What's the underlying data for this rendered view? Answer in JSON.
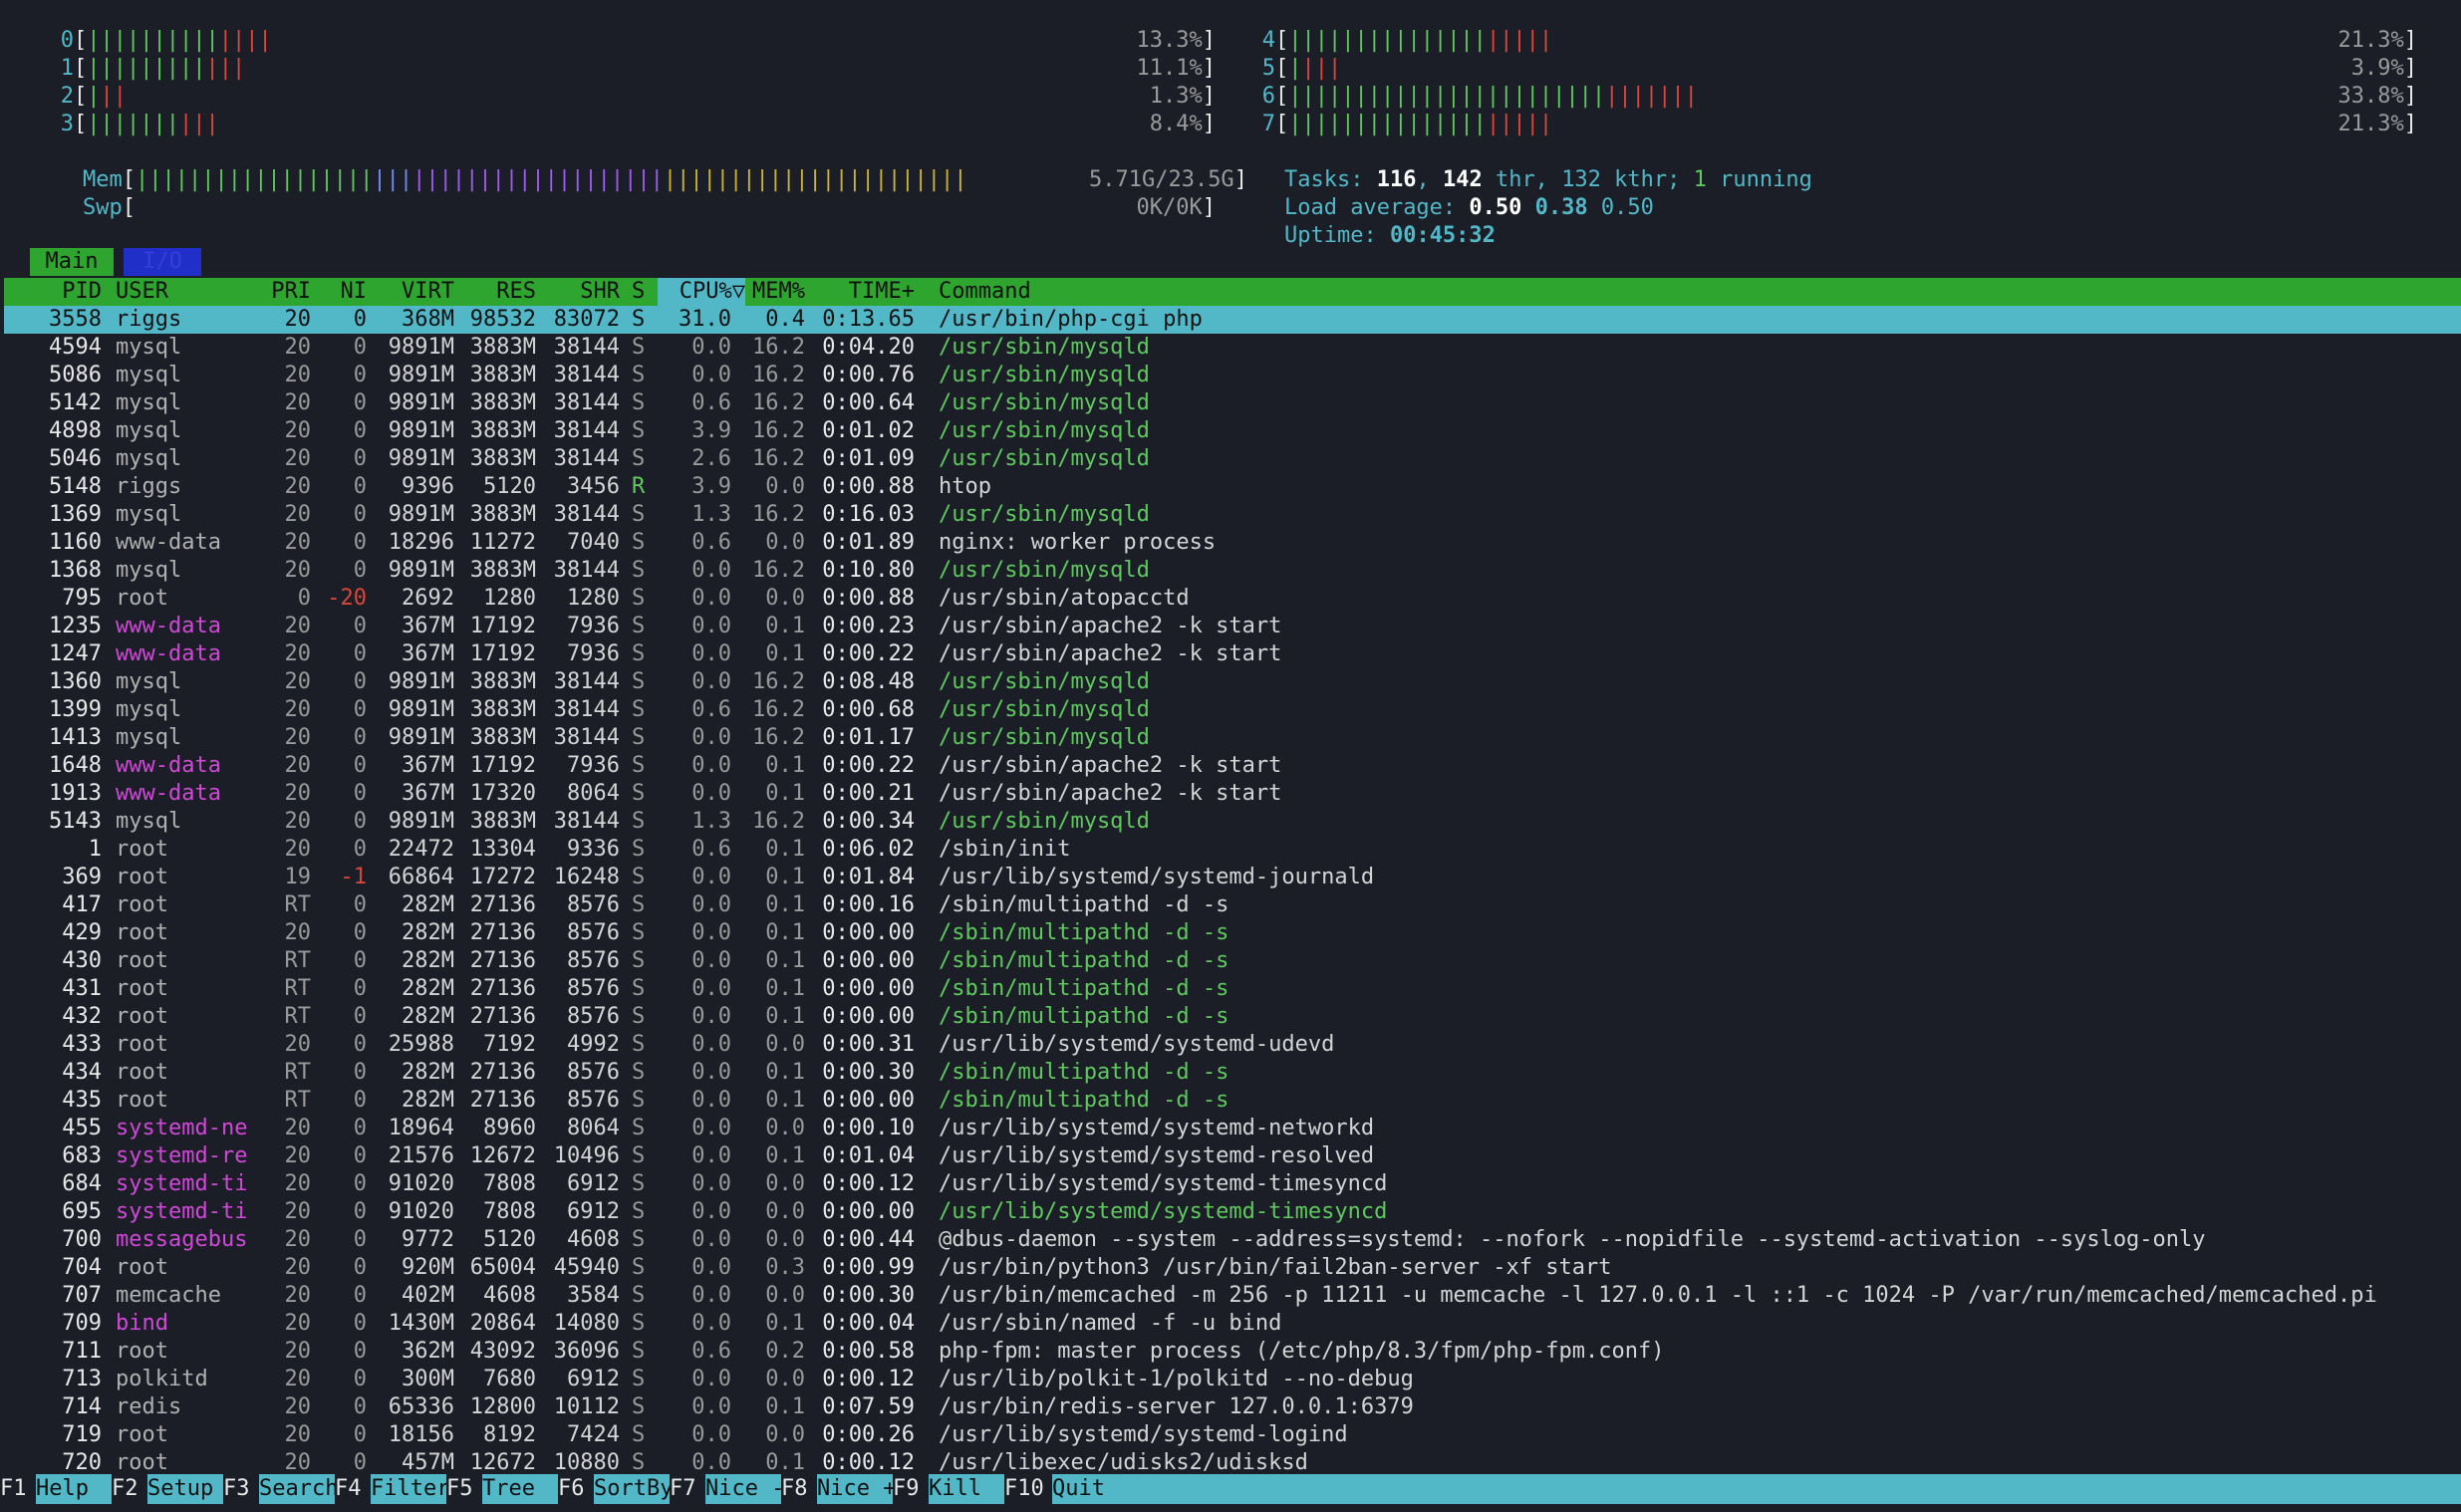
{
  "cpus": [
    {
      "label": "0",
      "green": 10,
      "red": 4,
      "value": "13.3%"
    },
    {
      "label": "1",
      "green": 9,
      "red": 3,
      "value": "11.1%"
    },
    {
      "label": "2",
      "green": 1,
      "red": 2,
      "value": "1.3%"
    },
    {
      "label": "3",
      "green": 7,
      "red": 3,
      "value": "8.4%"
    },
    {
      "label": "4",
      "green": 15,
      "red": 5,
      "value": "21.3%"
    },
    {
      "label": "5",
      "green": 1,
      "red": 3,
      "value": "3.9%"
    },
    {
      "label": "6",
      "green": 24,
      "red": 7,
      "value": "33.8%"
    },
    {
      "label": "7",
      "green": 15,
      "red": 5,
      "value": "21.3%"
    }
  ],
  "mem": {
    "label": "Mem",
    "green": 18,
    "blue": 3,
    "purple": 19,
    "yellow": 23,
    "value": "5.71G/23.5G"
  },
  "swp": {
    "label": "Swp",
    "value": "0K/0K"
  },
  "tasks": {
    "prefix": "Tasks: ",
    "tasks": "116",
    "sep1": ", ",
    "thr": "142",
    "thr_label": " thr, ",
    "kthr": "132",
    "kthr_label": " kthr; ",
    "running": "1",
    "running_label": " running"
  },
  "load": {
    "prefix": "Load average: ",
    "one": "0.50",
    "five": "0.38",
    "fifteen": "0.50"
  },
  "uptime": {
    "prefix": "Uptime: ",
    "value": "00:45:32"
  },
  "tabs": {
    "main": "Main",
    "io": "I/O"
  },
  "columns": {
    "pid": "PID",
    "user": "USER",
    "pri": "PRI",
    "ni": "NI",
    "virt": "VIRT",
    "res": "RES",
    "shr": "SHR",
    "s": "S",
    "cpu": "CPU%▽",
    "mem": "MEM%",
    "time": "TIME+",
    "command": "Command"
  },
  "processes": [
    {
      "pid": "3558",
      "user": "riggs",
      "pri": "20",
      "ni": "0",
      "virt": "368M",
      "res": "98532",
      "shr": "83072",
      "s": "S",
      "cpu": "31.0",
      "mem": "0.4",
      "time": "0:13.65",
      "cmd": "/usr/bin/php-cgi php",
      "selected": true
    },
    {
      "pid": "4594",
      "user": "mysql",
      "pri": "20",
      "ni": "0",
      "virt": "9891M",
      "res": "3883M",
      "shr": "38144",
      "s": "S",
      "cpu": "0.0",
      "mem": "16.2",
      "time": "0:04.20",
      "cmd": "/usr/sbin/mysqld",
      "thread": true
    },
    {
      "pid": "5086",
      "user": "mysql",
      "pri": "20",
      "ni": "0",
      "virt": "9891M",
      "res": "3883M",
      "shr": "38144",
      "s": "S",
      "cpu": "0.0",
      "mem": "16.2",
      "time": "0:00.76",
      "cmd": "/usr/sbin/mysqld",
      "thread": true
    },
    {
      "pid": "5142",
      "user": "mysql",
      "pri": "20",
      "ni": "0",
      "virt": "9891M",
      "res": "3883M",
      "shr": "38144",
      "s": "S",
      "cpu": "0.6",
      "mem": "16.2",
      "time": "0:00.64",
      "cmd": "/usr/sbin/mysqld",
      "thread": true
    },
    {
      "pid": "4898",
      "user": "mysql",
      "pri": "20",
      "ni": "0",
      "virt": "9891M",
      "res": "3883M",
      "shr": "38144",
      "s": "S",
      "cpu": "3.9",
      "mem": "16.2",
      "time": "0:01.02",
      "cmd": "/usr/sbin/mysqld",
      "thread": true
    },
    {
      "pid": "5046",
      "user": "mysql",
      "pri": "20",
      "ni": "0",
      "virt": "9891M",
      "res": "3883M",
      "shr": "38144",
      "s": "S",
      "cpu": "2.6",
      "mem": "16.2",
      "time": "0:01.09",
      "cmd": "/usr/sbin/mysqld",
      "thread": true
    },
    {
      "pid": "5148",
      "user": "riggs",
      "pri": "20",
      "ni": "0",
      "virt": "9396",
      "res": "5120",
      "shr": "3456",
      "s": "R",
      "cpu": "3.9",
      "mem": "0.0",
      "time": "0:00.88",
      "cmd": "htop"
    },
    {
      "pid": "1369",
      "user": "mysql",
      "pri": "20",
      "ni": "0",
      "virt": "9891M",
      "res": "3883M",
      "shr": "38144",
      "s": "S",
      "cpu": "1.3",
      "mem": "16.2",
      "time": "0:16.03",
      "cmd": "/usr/sbin/mysqld",
      "thread": true
    },
    {
      "pid": "1160",
      "user": "www-data",
      "pri": "20",
      "ni": "0",
      "virt": "18296",
      "res": "11272",
      "shr": "7040",
      "s": "S",
      "cpu": "0.6",
      "mem": "0.0",
      "time": "0:01.89",
      "cmd": "nginx: worker process"
    },
    {
      "pid": "1368",
      "user": "mysql",
      "pri": "20",
      "ni": "0",
      "virt": "9891M",
      "res": "3883M",
      "shr": "38144",
      "s": "S",
      "cpu": "0.0",
      "mem": "16.2",
      "time": "0:10.80",
      "cmd": "/usr/sbin/mysqld",
      "thread": true
    },
    {
      "pid": "795",
      "user": "root",
      "pri": "0",
      "ni": "-20",
      "virt": "2692",
      "res": "1280",
      "shr": "1280",
      "s": "S",
      "cpu": "0.0",
      "mem": "0.0",
      "time": "0:00.88",
      "cmd": "/usr/sbin/atopacctd"
    },
    {
      "pid": "1235",
      "user": "www-data",
      "pri": "20",
      "ni": "0",
      "virt": "367M",
      "res": "17192",
      "shr": "7936",
      "s": "S",
      "cpu": "0.0",
      "mem": "0.1",
      "time": "0:00.23",
      "cmd": "/usr/sbin/apache2 -k start",
      "user_magenta": true
    },
    {
      "pid": "1247",
      "user": "www-data",
      "pri": "20",
      "ni": "0",
      "virt": "367M",
      "res": "17192",
      "shr": "7936",
      "s": "S",
      "cpu": "0.0",
      "mem": "0.1",
      "time": "0:00.22",
      "cmd": "/usr/sbin/apache2 -k start",
      "user_magenta": true
    },
    {
      "pid": "1360",
      "user": "mysql",
      "pri": "20",
      "ni": "0",
      "virt": "9891M",
      "res": "3883M",
      "shr": "38144",
      "s": "S",
      "cpu": "0.0",
      "mem": "16.2",
      "time": "0:08.48",
      "cmd": "/usr/sbin/mysqld",
      "thread": true
    },
    {
      "pid": "1399",
      "user": "mysql",
      "pri": "20",
      "ni": "0",
      "virt": "9891M",
      "res": "3883M",
      "shr": "38144",
      "s": "S",
      "cpu": "0.6",
      "mem": "16.2",
      "time": "0:00.68",
      "cmd": "/usr/sbin/mysqld",
      "thread": true
    },
    {
      "pid": "1413",
      "user": "mysql",
      "pri": "20",
      "ni": "0",
      "virt": "9891M",
      "res": "3883M",
      "shr": "38144",
      "s": "S",
      "cpu": "0.0",
      "mem": "16.2",
      "time": "0:01.17",
      "cmd": "/usr/sbin/mysqld",
      "thread": true
    },
    {
      "pid": "1648",
      "user": "www-data",
      "pri": "20",
      "ni": "0",
      "virt": "367M",
      "res": "17192",
      "shr": "7936",
      "s": "S",
      "cpu": "0.0",
      "mem": "0.1",
      "time": "0:00.22",
      "cmd": "/usr/sbin/apache2 -k start",
      "user_magenta": true
    },
    {
      "pid": "1913",
      "user": "www-data",
      "pri": "20",
      "ni": "0",
      "virt": "367M",
      "res": "17320",
      "shr": "8064",
      "s": "S",
      "cpu": "0.0",
      "mem": "0.1",
      "time": "0:00.21",
      "cmd": "/usr/sbin/apache2 -k start",
      "user_magenta": true
    },
    {
      "pid": "5143",
      "user": "mysql",
      "pri": "20",
      "ni": "0",
      "virt": "9891M",
      "res": "3883M",
      "shr": "38144",
      "s": "S",
      "cpu": "1.3",
      "mem": "16.2",
      "time": "0:00.34",
      "cmd": "/usr/sbin/mysqld",
      "thread": true
    },
    {
      "pid": "1",
      "user": "root",
      "pri": "20",
      "ni": "0",
      "virt": "22472",
      "res": "13304",
      "shr": "9336",
      "s": "S",
      "cpu": "0.6",
      "mem": "0.1",
      "time": "0:06.02",
      "cmd": "/sbin/init"
    },
    {
      "pid": "369",
      "user": "root",
      "pri": "19",
      "ni": "-1",
      "virt": "66864",
      "res": "17272",
      "shr": "16248",
      "s": "S",
      "cpu": "0.0",
      "mem": "0.1",
      "time": "0:01.84",
      "cmd": "/usr/lib/systemd/systemd-journald"
    },
    {
      "pid": "417",
      "user": "root",
      "pri": "RT",
      "ni": "0",
      "virt": "282M",
      "res": "27136",
      "shr": "8576",
      "s": "S",
      "cpu": "0.0",
      "mem": "0.1",
      "time": "0:00.16",
      "cmd": "/sbin/multipathd -d -s"
    },
    {
      "pid": "429",
      "user": "root",
      "pri": "20",
      "ni": "0",
      "virt": "282M",
      "res": "27136",
      "shr": "8576",
      "s": "S",
      "cpu": "0.0",
      "mem": "0.1",
      "time": "0:00.00",
      "cmd": "/sbin/multipathd -d -s",
      "thread": true
    },
    {
      "pid": "430",
      "user": "root",
      "pri": "RT",
      "ni": "0",
      "virt": "282M",
      "res": "27136",
      "shr": "8576",
      "s": "S",
      "cpu": "0.0",
      "mem": "0.1",
      "time": "0:00.00",
      "cmd": "/sbin/multipathd -d -s",
      "thread": true
    },
    {
      "pid": "431",
      "user": "root",
      "pri": "RT",
      "ni": "0",
      "virt": "282M",
      "res": "27136",
      "shr": "8576",
      "s": "S",
      "cpu": "0.0",
      "mem": "0.1",
      "time": "0:00.00",
      "cmd": "/sbin/multipathd -d -s",
      "thread": true
    },
    {
      "pid": "432",
      "user": "root",
      "pri": "RT",
      "ni": "0",
      "virt": "282M",
      "res": "27136",
      "shr": "8576",
      "s": "S",
      "cpu": "0.0",
      "mem": "0.1",
      "time": "0:00.00",
      "cmd": "/sbin/multipathd -d -s",
      "thread": true
    },
    {
      "pid": "433",
      "user": "root",
      "pri": "20",
      "ni": "0",
      "virt": "25988",
      "res": "7192",
      "shr": "4992",
      "s": "S",
      "cpu": "0.0",
      "mem": "0.0",
      "time": "0:00.31",
      "cmd": "/usr/lib/systemd/systemd-udevd"
    },
    {
      "pid": "434",
      "user": "root",
      "pri": "RT",
      "ni": "0",
      "virt": "282M",
      "res": "27136",
      "shr": "8576",
      "s": "S",
      "cpu": "0.0",
      "mem": "0.1",
      "time": "0:00.30",
      "cmd": "/sbin/multipathd -d -s",
      "thread": true
    },
    {
      "pid": "435",
      "user": "root",
      "pri": "RT",
      "ni": "0",
      "virt": "282M",
      "res": "27136",
      "shr": "8576",
      "s": "S",
      "cpu": "0.0",
      "mem": "0.1",
      "time": "0:00.00",
      "cmd": "/sbin/multipathd -d -s",
      "thread": true
    },
    {
      "pid": "455",
      "user": "systemd-ne",
      "pri": "20",
      "ni": "0",
      "virt": "18964",
      "res": "8960",
      "shr": "8064",
      "s": "S",
      "cpu": "0.0",
      "mem": "0.0",
      "time": "0:00.10",
      "cmd": "/usr/lib/systemd/systemd-networkd",
      "user_magenta": true
    },
    {
      "pid": "683",
      "user": "systemd-re",
      "pri": "20",
      "ni": "0",
      "virt": "21576",
      "res": "12672",
      "shr": "10496",
      "s": "S",
      "cpu": "0.0",
      "mem": "0.1",
      "time": "0:01.04",
      "cmd": "/usr/lib/systemd/systemd-resolved",
      "user_magenta": true
    },
    {
      "pid": "684",
      "user": "systemd-ti",
      "pri": "20",
      "ni": "0",
      "virt": "91020",
      "res": "7808",
      "shr": "6912",
      "s": "S",
      "cpu": "0.0",
      "mem": "0.0",
      "time": "0:00.12",
      "cmd": "/usr/lib/systemd/systemd-timesyncd",
      "user_magenta": true
    },
    {
      "pid": "695",
      "user": "systemd-ti",
      "pri": "20",
      "ni": "0",
      "virt": "91020",
      "res": "7808",
      "shr": "6912",
      "s": "S",
      "cpu": "0.0",
      "mem": "0.0",
      "time": "0:00.00",
      "cmd": "/usr/lib/systemd/systemd-timesyncd",
      "user_magenta": true,
      "thread": true
    },
    {
      "pid": "700",
      "user": "messagebus",
      "pri": "20",
      "ni": "0",
      "virt": "9772",
      "res": "5120",
      "shr": "4608",
      "s": "S",
      "cpu": "0.0",
      "mem": "0.0",
      "time": "0:00.44",
      "cmd": "@dbus-daemon --system --address=systemd: --nofork --nopidfile --systemd-activation --syslog-only",
      "user_magenta": true
    },
    {
      "pid": "704",
      "user": "root",
      "pri": "20",
      "ni": "0",
      "virt": "920M",
      "res": "65004",
      "shr": "45940",
      "s": "S",
      "cpu": "0.0",
      "mem": "0.3",
      "time": "0:00.99",
      "cmd": "/usr/bin/python3 /usr/bin/fail2ban-server -xf start"
    },
    {
      "pid": "707",
      "user": "memcache",
      "pri": "20",
      "ni": "0",
      "virt": "402M",
      "res": "4608",
      "shr": "3584",
      "s": "S",
      "cpu": "0.0",
      "mem": "0.0",
      "time": "0:00.30",
      "cmd": "/usr/bin/memcached -m 256 -p 11211 -u memcache -l 127.0.0.1 -l ::1 -c 1024 -P /var/run/memcached/memcached.pi"
    },
    {
      "pid": "709",
      "user": "bind",
      "pri": "20",
      "ni": "0",
      "virt": "1430M",
      "res": "20864",
      "shr": "14080",
      "s": "S",
      "cpu": "0.0",
      "mem": "0.1",
      "time": "0:00.04",
      "cmd": "/usr/sbin/named -f -u bind",
      "user_magenta": true
    },
    {
      "pid": "711",
      "user": "root",
      "pri": "20",
      "ni": "0",
      "virt": "362M",
      "res": "43092",
      "shr": "36096",
      "s": "S",
      "cpu": "0.6",
      "mem": "0.2",
      "time": "0:00.58",
      "cmd": "php-fpm: master process (/etc/php/8.3/fpm/php-fpm.conf)"
    },
    {
      "pid": "713",
      "user": "polkitd",
      "pri": "20",
      "ni": "0",
      "virt": "300M",
      "res": "7680",
      "shr": "6912",
      "s": "S",
      "cpu": "0.0",
      "mem": "0.0",
      "time": "0:00.12",
      "cmd": "/usr/lib/polkit-1/polkitd --no-debug"
    },
    {
      "pid": "714",
      "user": "redis",
      "pri": "20",
      "ni": "0",
      "virt": "65336",
      "res": "12800",
      "shr": "10112",
      "s": "S",
      "cpu": "0.0",
      "mem": "0.1",
      "time": "0:07.59",
      "cmd": "/usr/bin/redis-server 127.0.0.1:6379"
    },
    {
      "pid": "719",
      "user": "root",
      "pri": "20",
      "ni": "0",
      "virt": "18156",
      "res": "8192",
      "shr": "7424",
      "s": "S",
      "cpu": "0.0",
      "mem": "0.0",
      "time": "0:00.26",
      "cmd": "/usr/lib/systemd/systemd-logind"
    },
    {
      "pid": "720",
      "user": "root",
      "pri": "20",
      "ni": "0",
      "virt": "457M",
      "res": "12672",
      "shr": "10880",
      "s": "S",
      "cpu": "0.0",
      "mem": "0.1",
      "time": "0:00.12",
      "cmd": "/usr/libexec/udisks2/udisksd"
    }
  ],
  "footer": [
    {
      "key": "F1",
      "label": "Help"
    },
    {
      "key": "F2",
      "label": "Setup"
    },
    {
      "key": "F3",
      "label": "Search"
    },
    {
      "key": "F4",
      "label": "Filter"
    },
    {
      "key": "F5",
      "label": "Tree"
    },
    {
      "key": "F6",
      "label": "SortBy"
    },
    {
      "key": "F7",
      "label": "Nice -"
    },
    {
      "key": "F8",
      "label": "Nice +"
    },
    {
      "key": "F9",
      "label": "Kill"
    },
    {
      "key": "F10",
      "label": "Quit"
    }
  ],
  "colors": {
    "bg": "#1b1e26",
    "cyan": "#52b8c8",
    "green": "#5fc85f",
    "red": "#d9473b",
    "magenta": "#d048d8",
    "header_bg": "#2ea52e"
  }
}
